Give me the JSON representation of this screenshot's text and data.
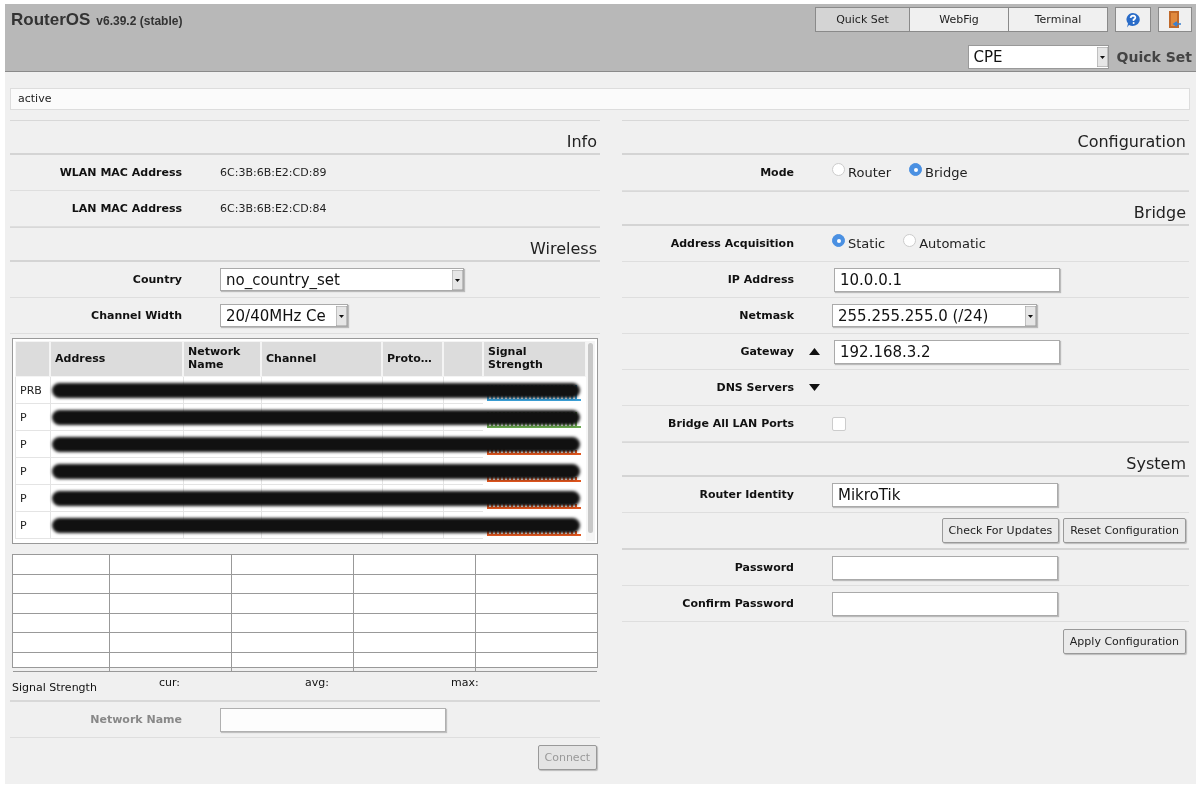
{
  "header": {
    "brand": "RouterOS",
    "version": "v6.39.2 (stable)",
    "tabs": [
      {
        "label": "Quick Set",
        "selected": true
      },
      {
        "label": "WebFig",
        "selected": false
      },
      {
        "label": "Terminal",
        "selected": false
      }
    ],
    "mode_select": "CPE",
    "title": "Quick Set"
  },
  "status": "active",
  "info": {
    "title": "Info",
    "rows": [
      {
        "label": "WLAN MAC Address",
        "value": "6C:3B:6B:E2:CD:89"
      },
      {
        "label": "LAN MAC Address",
        "value": "6C:3B:6B:E2:CD:84"
      }
    ]
  },
  "wireless": {
    "title": "Wireless",
    "fields": [
      {
        "label": "Country",
        "value": "no_country_set"
      },
      {
        "label": "Channel Width",
        "value": "20/40MHz Ce"
      }
    ],
    "scan_table": {
      "columns": [
        {
          "kind": "blank"
        },
        {
          "kind": "text",
          "label": "Address"
        },
        {
          "kind": "text",
          "label": "Network Name"
        },
        {
          "kind": "text",
          "label": "Channel"
        },
        {
          "kind": "text",
          "label": "Proto…"
        },
        {
          "kind": "blank"
        },
        {
          "kind": "text",
          "label": "Signal Strength"
        }
      ],
      "rows": [
        {
          "flags": "PRB",
          "color": "#3aa0d8",
          "kind": "strong"
        },
        {
          "flags": "P",
          "color": "#6aa84f",
          "kind": "strong"
        },
        {
          "flags": "P",
          "color": "#e0541c",
          "kind": "weak"
        },
        {
          "flags": "P",
          "color": "#e0541c",
          "kind": "weak"
        },
        {
          "flags": "P",
          "color": "#e0541c",
          "kind": "weak"
        },
        {
          "flags": "P",
          "color": "#e0541c",
          "kind": "weak"
        }
      ]
    },
    "signal": {
      "label": "Signal Strength",
      "stats": [
        "cur:",
        "avg:",
        "max:"
      ]
    },
    "network_name": {
      "label": "Network Name",
      "disabled": true
    },
    "connect": {
      "label": "Connect",
      "disabled": true
    }
  },
  "configuration": {
    "title": "Configuration",
    "mode": {
      "label": "Mode",
      "options": [
        {
          "label": "Router",
          "selected": false
        },
        {
          "label": "Bridge",
          "selected": true
        }
      ]
    }
  },
  "bridge": {
    "title": "Bridge",
    "fields": [
      {
        "kind": "radio",
        "label": "Address Acquisition",
        "options": [
          {
            "label": "Static",
            "selected": true
          },
          {
            "label": "Automatic",
            "selected": false
          }
        ]
      },
      {
        "kind": "text",
        "label": "IP Address",
        "value": "10.0.0.1"
      },
      {
        "kind": "select",
        "label": "Netmask",
        "value": "255.255.255.0 (/24)"
      },
      {
        "kind": "text",
        "label": "Gateway",
        "value": "192.168.3.2",
        "expanded": true
      },
      {
        "kind": "toggle",
        "label": "DNS Servers",
        "expanded": false
      },
      {
        "kind": "checkbox",
        "label": "Bridge All LAN Ports",
        "checked": false
      }
    ]
  },
  "system": {
    "title": "System",
    "identity": {
      "label": "Router Identity",
      "value": "MikroTik"
    },
    "buttons": [
      "Check For Updates",
      "Reset Configuration"
    ],
    "passwords": [
      {
        "label": "Password"
      },
      {
        "label": "Confirm Password"
      }
    ],
    "apply": "Apply Configuration"
  }
}
